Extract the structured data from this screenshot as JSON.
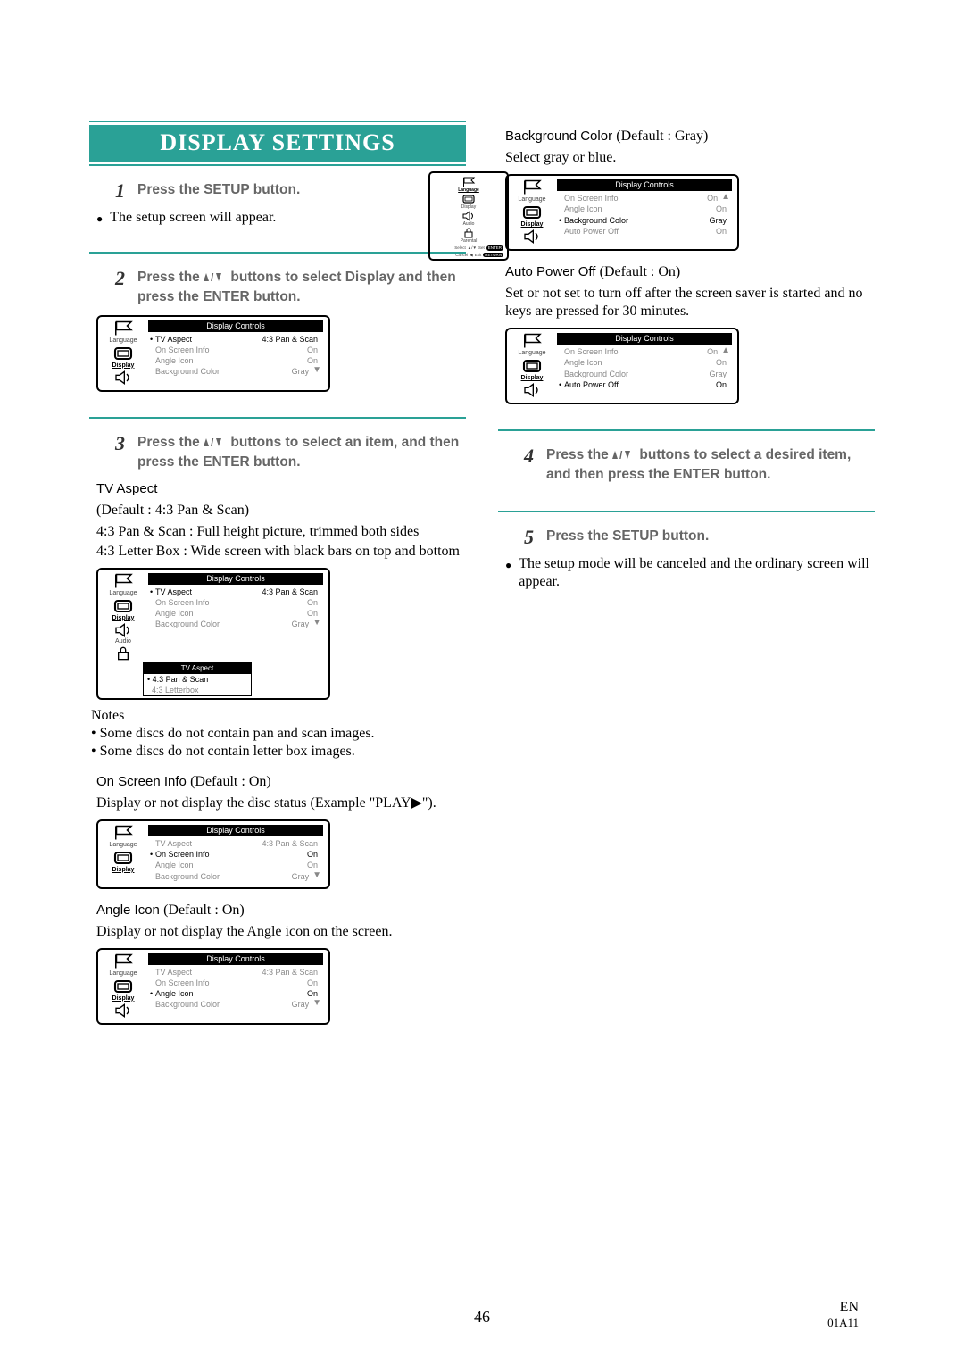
{
  "heading": "DISPLAY SETTINGS",
  "steps": {
    "s1": {
      "num": "1",
      "text": "Press the SETUP button."
    },
    "s2": {
      "num": "2",
      "text_a": "Press the ",
      "text_b": " buttons to select Display and then press the ENTER button."
    },
    "s3": {
      "num": "3",
      "text_a": "Press the ",
      "text_b": " buttons to select an item, and then press the ENTER button."
    },
    "s4": {
      "num": "4",
      "text_a": "Press the ",
      "text_b": " buttons to select a desired item, and then press the ENTER button."
    },
    "s5": {
      "num": "5",
      "text": "Press the SETUP button."
    }
  },
  "body": {
    "setup_appear": "The setup screen will appear.",
    "tv_aspect_head": "TV Aspect",
    "tv_aspect_default": "(Default : 4:3 Pan & Scan)",
    "tv_aspect_l1": "4:3 Pan & Scan : Full height picture, trimmed both sides",
    "tv_aspect_l2": "4:3 Letter Box : Wide screen with black bars on top and bottom",
    "notes_head": "Notes",
    "note1": "• Some discs do not contain pan and scan images.",
    "note2": "• Some discs do not contain letter box images.",
    "onscreen_head": "On Screen Info ",
    "onscreen_def": "(Default : On)",
    "onscreen_body_a": "Display or not display the disc status (Example \"PLAY",
    "onscreen_body_b": "\").",
    "angle_head": "Angle Icon ",
    "angle_def": "(Default : On)",
    "angle_body": "Display or not display the Angle icon on the screen.",
    "bg_head": "Background Color ",
    "bg_def": "(Default : Gray)",
    "bg_body": "Select gray or blue.",
    "apo_head": "Auto Power Off ",
    "apo_def": "(Default : On)",
    "apo_body": "Set or not set to turn off after the screen saver is started and no keys are pressed for 30 minutes.",
    "cancel_body": "The setup mode will be canceled and the ordinary screen will appear."
  },
  "osd": {
    "title": "Display Controls",
    "labels": {
      "language": "Language",
      "display": "Display",
      "audio": "Audio",
      "parental": "Parental"
    },
    "rows": {
      "tv_aspect": "TV Aspect",
      "on_screen": "On Screen Info",
      "angle": "Angle Icon",
      "bg": "Background Color",
      "apo": "Auto Power Off"
    },
    "vals": {
      "pan": "4:3 Pan & Scan",
      "on": "On",
      "gray": "Gray"
    },
    "sub_title": "TV Aspect",
    "sub_opts": {
      "a": "4:3 Pan & Scan",
      "b": "4:3 Letterbox"
    },
    "mini_footer": {
      "select": "Select",
      "set": "Set",
      "enter": "ENTER",
      "cancel": "Cancel",
      "exit": "Exit",
      "return": "RETURN"
    }
  },
  "footer": {
    "page": "– 46 –",
    "lang": "EN",
    "code": "01A11"
  }
}
